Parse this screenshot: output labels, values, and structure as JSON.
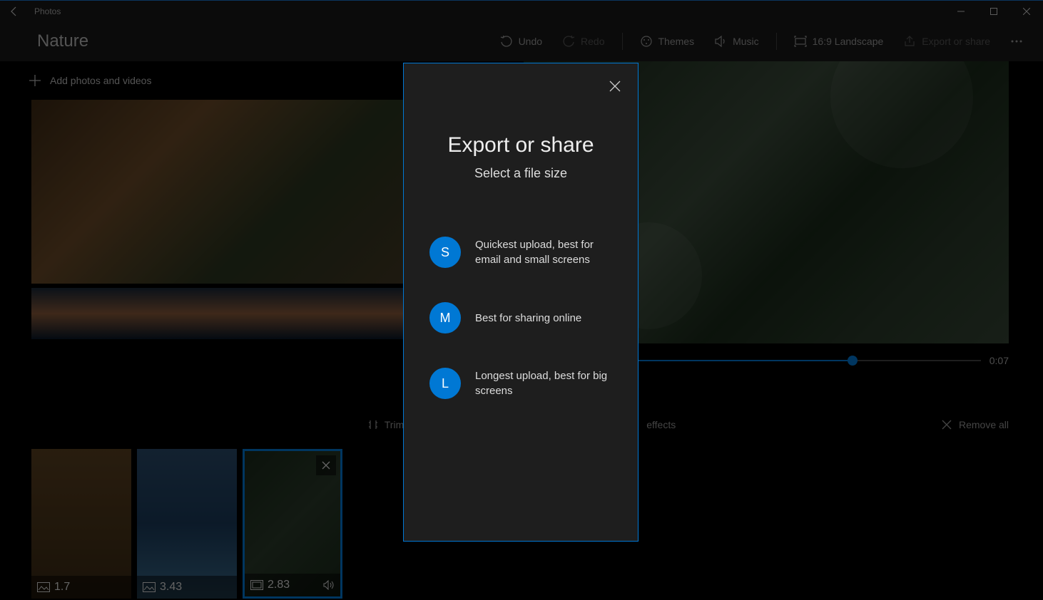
{
  "titlebar": {
    "app_name": "Photos"
  },
  "commandbar": {
    "project_title": "Nature",
    "undo": "Undo",
    "redo": "Redo",
    "themes": "Themes",
    "music": "Music",
    "aspect": "16:9 Landscape",
    "export": "Export or share"
  },
  "library": {
    "add_label": "Add photos and videos"
  },
  "preview": {
    "time": "0:07"
  },
  "clip_tools": {
    "trim": "Trim",
    "effects": "effects",
    "remove_all": "Remove all"
  },
  "clips": [
    {
      "duration": "1.7",
      "type": "image"
    },
    {
      "duration": "3.43",
      "type": "image"
    },
    {
      "duration": "2.83",
      "type": "video",
      "selected": true
    }
  ],
  "dialog": {
    "title": "Export or share",
    "subtitle": "Select a file size",
    "options": [
      {
        "badge": "S",
        "desc": "Quickest upload, best for email and small screens"
      },
      {
        "badge": "M",
        "desc": "Best for sharing online"
      },
      {
        "badge": "L",
        "desc": "Longest upload, best for big screens"
      }
    ]
  }
}
